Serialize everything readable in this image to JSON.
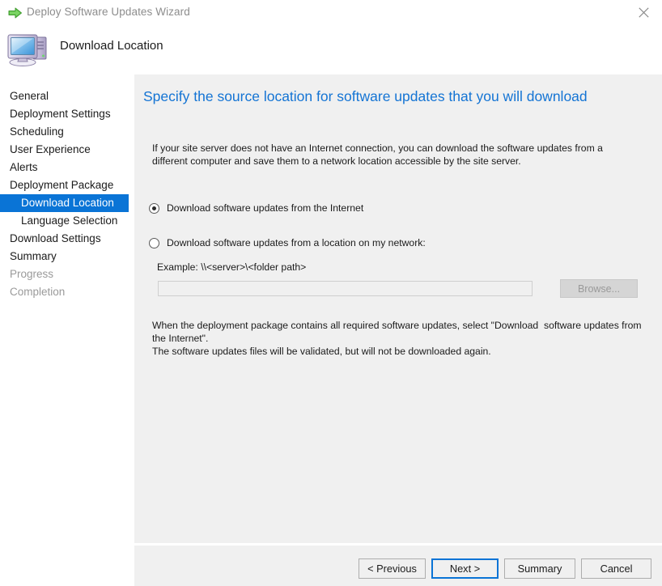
{
  "window": {
    "title": "Deploy Software Updates Wizard",
    "title_icon": "green-right-arrow-icon",
    "close_icon": "close-icon",
    "header_icon": "computer-icon",
    "header_title": "Download Location"
  },
  "sidebar": {
    "items": [
      {
        "label": "General",
        "state": "normal",
        "level": 0
      },
      {
        "label": "Deployment Settings",
        "state": "normal",
        "level": 0
      },
      {
        "label": "Scheduling",
        "state": "normal",
        "level": 0
      },
      {
        "label": "User Experience",
        "state": "normal",
        "level": 0
      },
      {
        "label": "Alerts",
        "state": "normal",
        "level": 0
      },
      {
        "label": "Deployment Package",
        "state": "normal",
        "level": 0
      },
      {
        "label": "Download Location",
        "state": "selected",
        "level": 1
      },
      {
        "label": "Language Selection",
        "state": "normal",
        "level": 1
      },
      {
        "label": "Download Settings",
        "state": "normal",
        "level": 0
      },
      {
        "label": "Summary",
        "state": "normal",
        "level": 0
      },
      {
        "label": "Progress",
        "state": "disabled",
        "level": 0
      },
      {
        "label": "Completion",
        "state": "disabled",
        "level": 0
      }
    ],
    "selected_bg": "#0a74d6"
  },
  "main": {
    "heading": "Specify the source location for software updates that you will download",
    "heading_color": "#1474d4",
    "intro_text": "If your site server does not have an Internet connection, you can download the software updates from a different computer and save them to a network location accessible by the site server.",
    "options": [
      {
        "label": "Download software updates from the Internet",
        "checked": true
      },
      {
        "label": "Download software updates from a location on my network:",
        "checked": false
      }
    ],
    "example_label": "Example: \\\\<server>\\<folder path>",
    "path_input": {
      "value": "",
      "placeholder": "",
      "disabled": true
    },
    "browse_button": {
      "label": "Browse...",
      "disabled": true
    },
    "note_text": "When the deployment package contains all required software updates, select \"Download  software updates from the Internet\".\nThe software updates files will be validated, but will not be downloaded again."
  },
  "footer": {
    "previous_label": "< Previous",
    "next_label": "Next >",
    "summary_label": "Summary",
    "cancel_label": "Cancel",
    "focus_color": "#0a74d6"
  }
}
